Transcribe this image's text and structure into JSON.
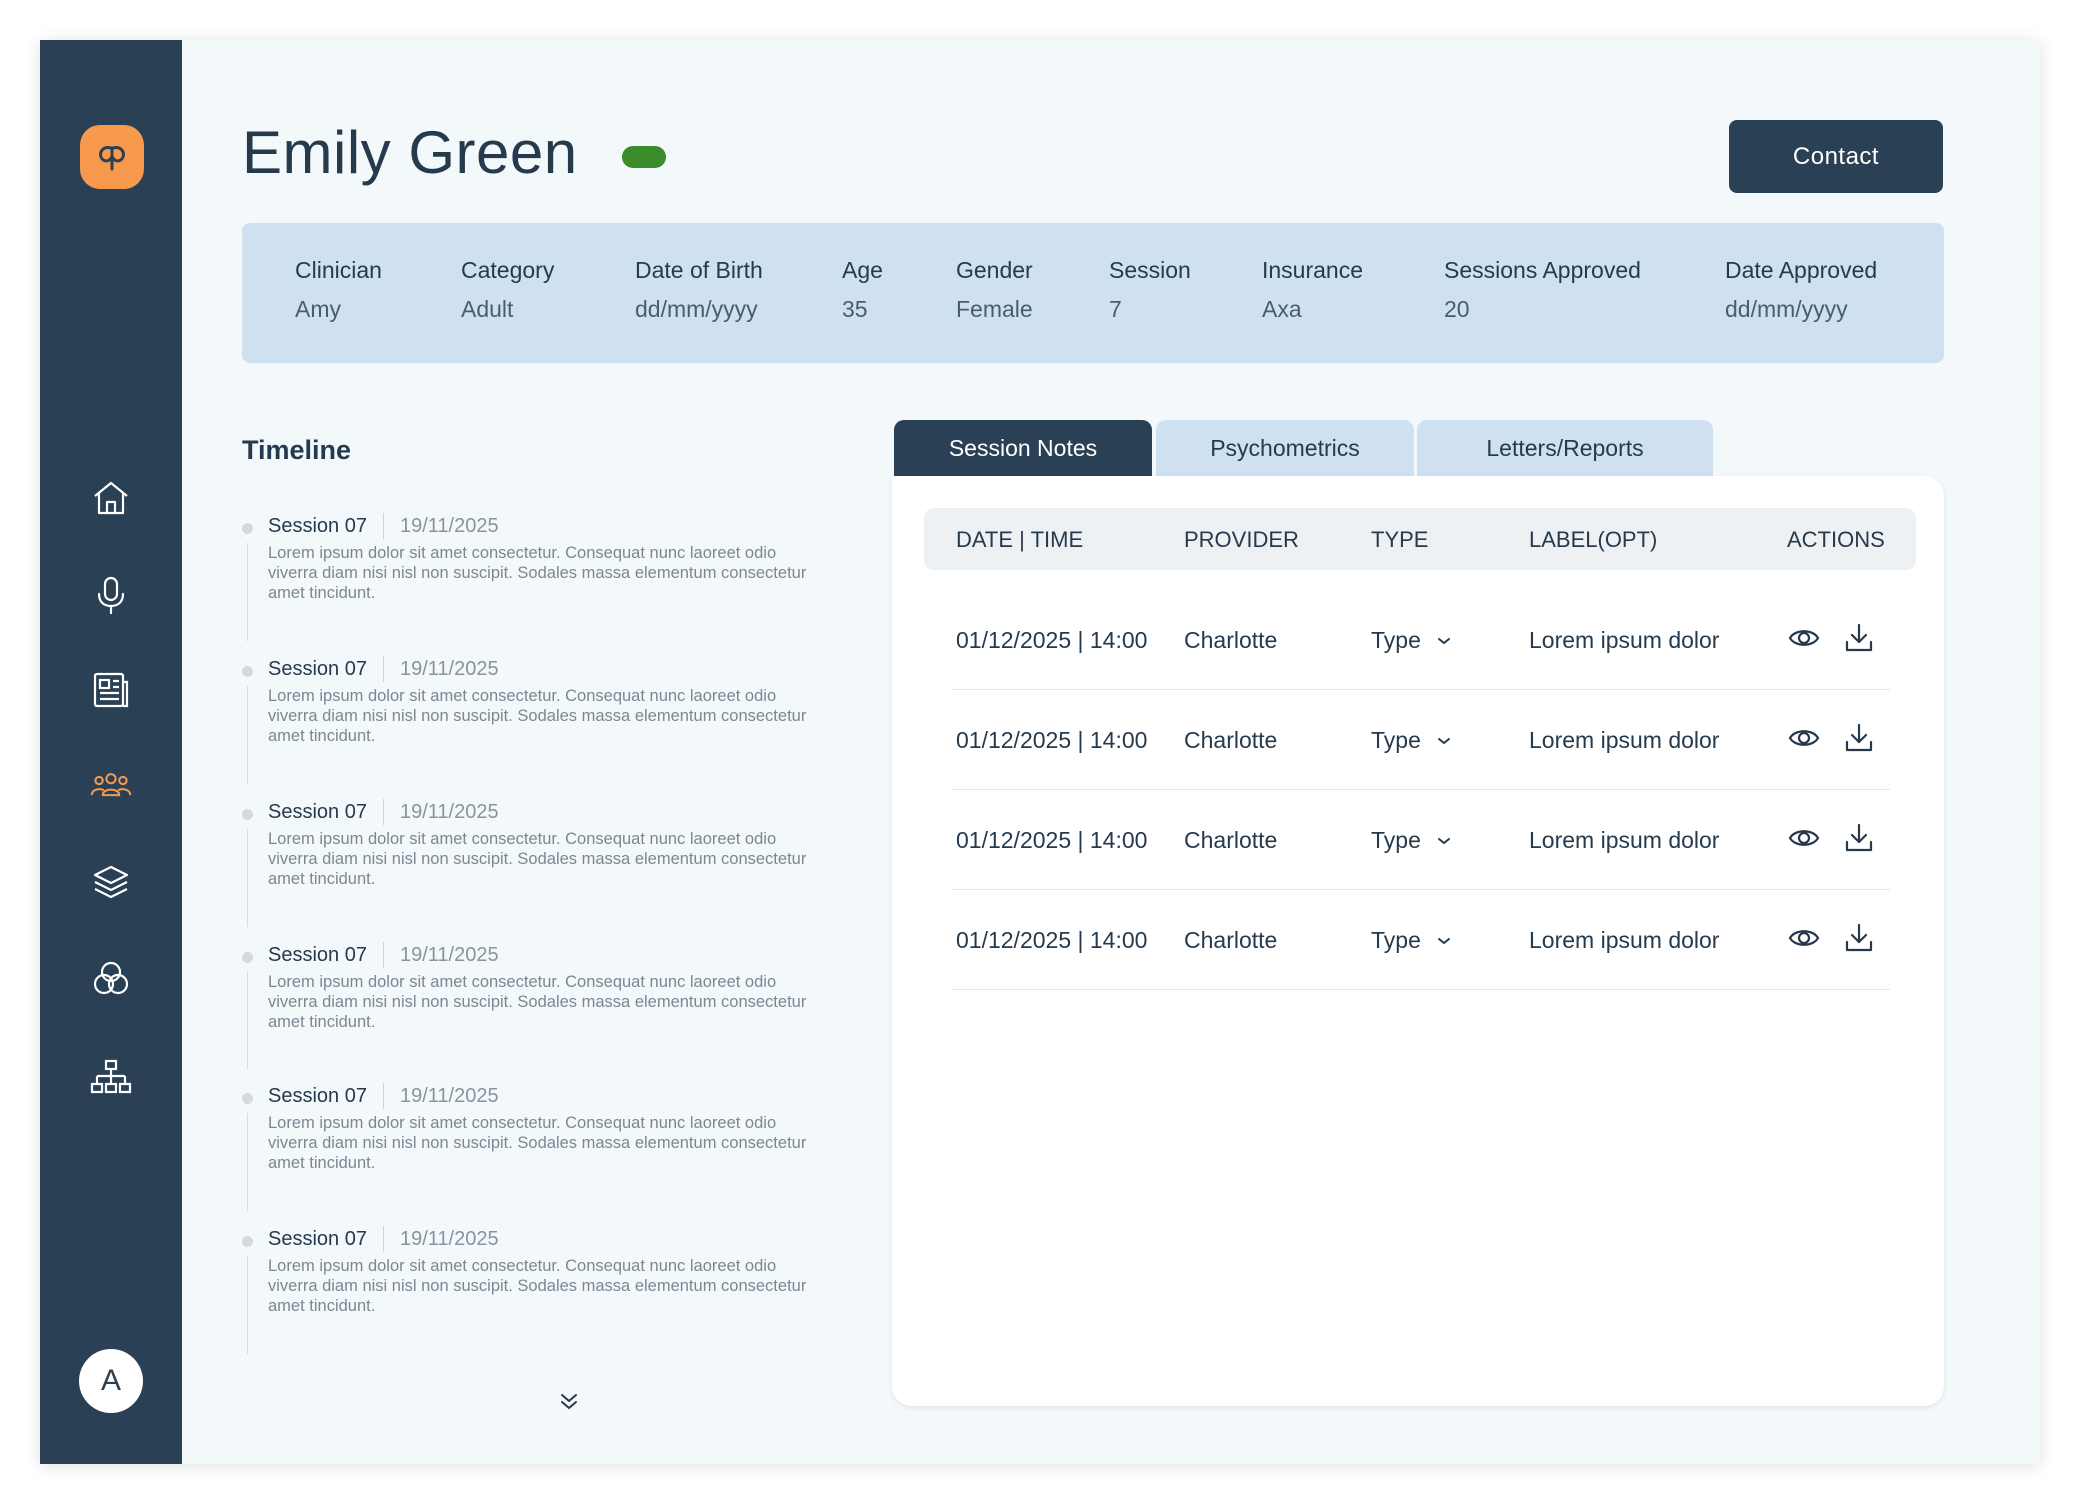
{
  "colors": {
    "sidebar": "#2a4055",
    "accent_orange": "#f89a4e",
    "status_active": "#3a8c2a",
    "info_bar": "#cfe0f0",
    "background": "#f3f8fb"
  },
  "sidebar": {
    "logo_icon": "cp-logo-icon",
    "items": [
      {
        "icon": "home-icon",
        "active": false
      },
      {
        "icon": "microphone-icon",
        "active": false
      },
      {
        "icon": "newspaper-icon",
        "active": false
      },
      {
        "icon": "clients-group-icon",
        "active": true
      },
      {
        "icon": "layers-icon",
        "active": false
      },
      {
        "icon": "venn-circles-icon",
        "active": false
      },
      {
        "icon": "org-chart-icon",
        "active": false
      }
    ],
    "avatar_initial": "A"
  },
  "header": {
    "title": "Emily Green",
    "contact_label": "Contact"
  },
  "info": [
    {
      "label": "Clinician",
      "value": "Amy"
    },
    {
      "label": "Category",
      "value": "Adult"
    },
    {
      "label": "Date of Birth",
      "value": "dd/mm/yyyy"
    },
    {
      "label": "Age",
      "value": "35"
    },
    {
      "label": "Gender",
      "value": "Female"
    },
    {
      "label": "Session",
      "value": "7"
    },
    {
      "label": "Insurance",
      "value": "Axa"
    },
    {
      "label": "Sessions Approved",
      "value": "20"
    },
    {
      "label": "Date Approved",
      "value": "dd/mm/yyyy"
    }
  ],
  "timeline": {
    "title": "Timeline",
    "items": [
      {
        "session": "Session 07",
        "date": "19/11/2025",
        "text": "Lorem ipsum dolor sit amet consectetur. Consequat nunc laoreet odio viverra diam nisi nisl non suscipit. Sodales massa elementum consectetur amet tincidunt."
      },
      {
        "session": "Session 07",
        "date": "19/11/2025",
        "text": "Lorem ipsum dolor sit amet consectetur. Consequat nunc laoreet odio viverra diam nisi nisl non suscipit. Sodales massa elementum consectetur amet tincidunt."
      },
      {
        "session": "Session 07",
        "date": "19/11/2025",
        "text": "Lorem ipsum dolor sit amet consectetur. Consequat nunc laoreet odio viverra diam nisi nisl non suscipit. Sodales massa elementum consectetur amet tincidunt."
      },
      {
        "session": "Session 07",
        "date": "19/11/2025",
        "text": "Lorem ipsum dolor sit amet consectetur. Consequat nunc laoreet odio viverra diam nisi nisl non suscipit. Sodales massa elementum consectetur amet tincidunt."
      },
      {
        "session": "Session 07",
        "date": "19/11/2025",
        "text": "Lorem ipsum dolor sit amet consectetur. Consequat nunc laoreet odio viverra diam nisi nisl non suscipit. Sodales massa elementum consectetur amet tincidunt."
      },
      {
        "session": "Session 07",
        "date": "19/11/2025",
        "text": "Lorem ipsum dolor sit amet consectetur. Consequat nunc laoreet odio viverra diam nisi nisl non suscipit. Sodales massa elementum consectetur amet tincidunt."
      }
    ],
    "more_icon": "chevrons-down-icon"
  },
  "tabs": [
    {
      "label": "Session Notes",
      "active": true
    },
    {
      "label": "Psychometrics",
      "active": false
    },
    {
      "label": "Letters/Reports",
      "active": false
    }
  ],
  "table": {
    "columns": [
      "DATE | TIME",
      "PROVIDER",
      "TYPE",
      "LABEL(OPT)",
      "ACTIONS"
    ],
    "rows": [
      {
        "datetime": "01/12/2025 | 14:00",
        "provider": "Charlotte",
        "type": "Type",
        "label": "Lorem ipsum dolor"
      },
      {
        "datetime": "01/12/2025 | 14:00",
        "provider": "Charlotte",
        "type": "Type",
        "label": "Lorem ipsum dolor"
      },
      {
        "datetime": "01/12/2025 | 14:00",
        "provider": "Charlotte",
        "type": "Type",
        "label": "Lorem ipsum dolor"
      },
      {
        "datetime": "01/12/2025 | 14:00",
        "provider": "Charlotte",
        "type": "Type",
        "label": "Lorem ipsum dolor"
      }
    ],
    "actions": [
      "eye-icon",
      "download-icon"
    ]
  }
}
